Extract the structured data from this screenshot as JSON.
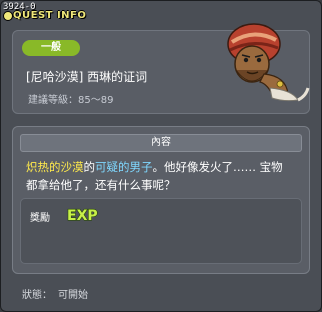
{
  "window": {
    "id_label": "3924-0",
    "title": "QUEST INFO"
  },
  "quest": {
    "category": "一般",
    "name": "[尼哈沙漠] 西琳的证词",
    "level": "建議等級：85～89"
  },
  "content": {
    "header": "內容",
    "desc_part1": "炽热的沙漠",
    "desc_part2": "的",
    "desc_part3": "可疑的男子",
    "desc_part4": "。他好像发火了…… 宝物",
    "desc_line2": "都拿给他了，还有什么事呢？"
  },
  "reward": {
    "label": "獎勵",
    "exp_text": "EXP"
  },
  "status": {
    "label": "狀態：",
    "value": "可開始"
  },
  "colors": {
    "accent_green": "#89b928",
    "highlight_yellow": "#ffea4c",
    "highlight_cyan": "#7fd8ff",
    "title_yellow": "#f0e87a"
  },
  "icons": {
    "npc": "npc-portrait",
    "exp": "exp-icon"
  }
}
